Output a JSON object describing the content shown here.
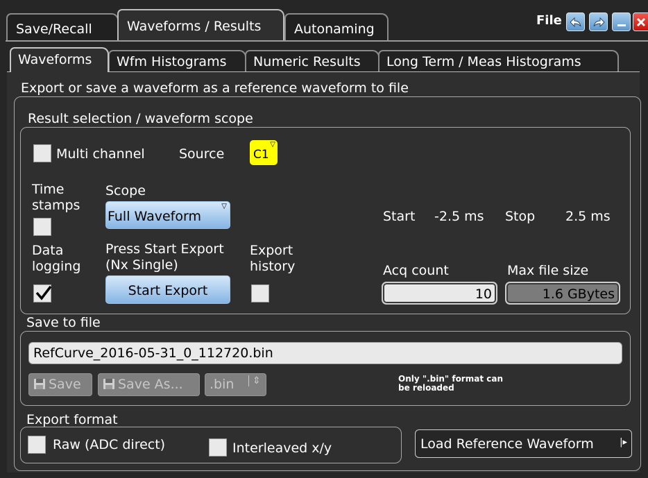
{
  "top_tabs": [
    {
      "label": "Save/Recall"
    },
    {
      "label": "Waveforms / Results"
    },
    {
      "label": "Autonaming"
    }
  ],
  "window": {
    "file_label": "File",
    "icons": [
      "back-icon",
      "forward-icon",
      "minimize-icon",
      "close-icon"
    ]
  },
  "sub_tabs": [
    {
      "label": "Waveforms"
    },
    {
      "label": "Wfm Histograms"
    },
    {
      "label": "Numeric Results"
    },
    {
      "label": "Long Term / Meas Histograms"
    }
  ],
  "description": "Export or save a waveform as a reference waveform to file",
  "result_selection": {
    "title": "Result selection / waveform scope",
    "multi_channel_label": "Multi channel",
    "multi_channel_checked": false,
    "source_label": "Source",
    "source_value": "C1",
    "time_stamps_label_1": "Time",
    "time_stamps_label_2": "stamps",
    "time_stamps_checked": false,
    "scope_label": "Scope",
    "scope_value": "Full Waveform",
    "start_label": "Start",
    "start_value": "-2.5 ms",
    "stop_label": "Stop",
    "stop_value": "2.5 ms",
    "data_logging_label_1": "Data",
    "data_logging_label_2": "logging",
    "data_logging_checked": true,
    "press_start_label_1": "Press Start Export",
    "press_start_label_2": "(Nx Single)",
    "start_export_button": "Start Export",
    "export_history_label_1": "Export",
    "export_history_label_2": "history",
    "export_history_checked": false,
    "acq_count_label": "Acq count",
    "acq_count_value": "10",
    "max_file_size_label": "Max file size",
    "max_file_size_value": "1.6",
    "max_file_size_unit": "GBytes"
  },
  "save_to_file": {
    "title": "Save to file",
    "filename": "RefCurve_2016-05-31_0_112720.bin",
    "save_button": "Save",
    "save_as_button": "Save As...",
    "format_value": ".bin",
    "note_line_1": "Only \".bin\" format can",
    "note_line_2": "be reloaded"
  },
  "export_format": {
    "title": "Export format",
    "raw_label": "Raw (ADC direct)",
    "raw_checked": false,
    "interleaved_label": "Interleaved x/y",
    "interleaved_checked": false
  },
  "load_reference_button": "Load Reference Waveform",
  "colors": {
    "accent_blue": "#86b5e3",
    "source_yellow": "#ffff00",
    "close_red": "#c4140b",
    "panel": "#2f2f2f"
  }
}
